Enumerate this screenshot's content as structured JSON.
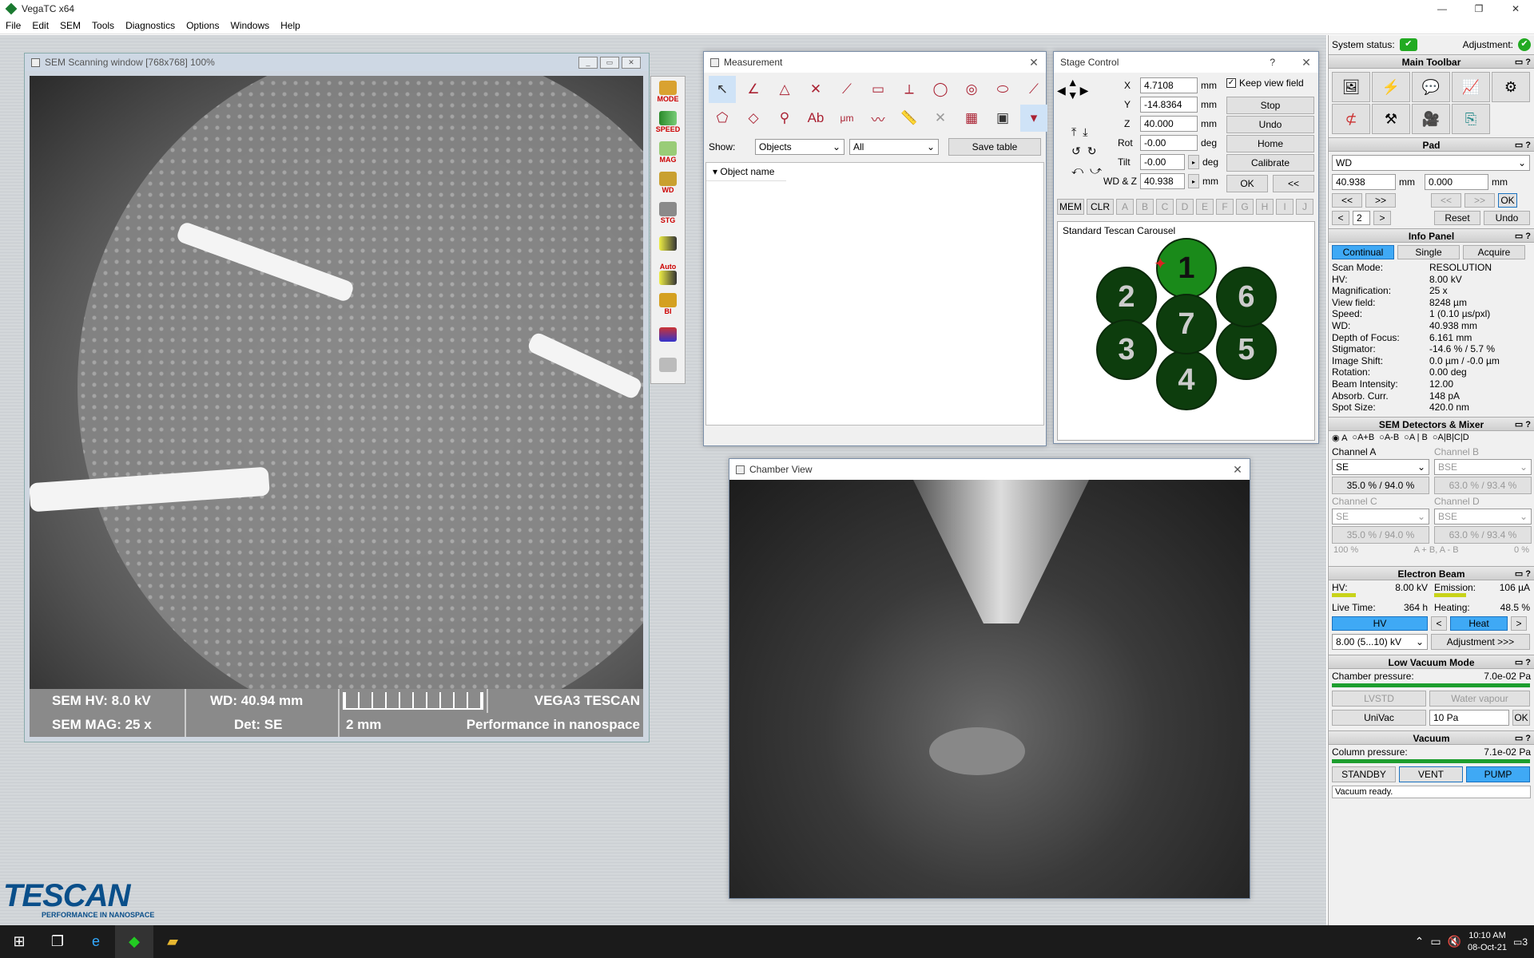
{
  "app": {
    "title": "VegaTC x64"
  },
  "menu": [
    "File",
    "Edit",
    "SEM",
    "Tools",
    "Diagnostics",
    "Options",
    "Windows",
    "Help"
  ],
  "sem_window": {
    "title": "SEM Scanning window [768x768] 100%",
    "hv": "SEM HV: 8.0 kV",
    "wd": "WD: 40.94 mm",
    "brand": "VEGA3 TESCAN",
    "mag": "SEM MAG: 25 x",
    "det": "Det: SE",
    "scale": "2 mm",
    "slogan": "Performance in nanospace"
  },
  "side_tools": [
    "MODE",
    "SPEED",
    "MAG",
    "WD",
    "STG",
    "",
    "Auto",
    "BI",
    "",
    ""
  ],
  "measurement": {
    "title": "Measurement",
    "show_label": "Show:",
    "show_value": "Objects",
    "filter_value": "All",
    "save_label": "Save table",
    "col_header": "Object name"
  },
  "stage": {
    "title": "Stage Control",
    "help": "?",
    "x_label": "X",
    "x": "4.7108",
    "y_label": "Y",
    "y": "-14.8364",
    "z_label": "Z",
    "z": "40.000",
    "rot_label": "Rot",
    "rot": "-0.00",
    "tilt_label": "Tilt",
    "tilt": "-0.00",
    "wdz_label": "WD & Z",
    "wdz": "40.938",
    "mm": "mm",
    "deg": "deg",
    "keep_view": "Keep view field",
    "stop": "Stop",
    "undo": "Undo",
    "home": "Home",
    "calibrate": "Calibrate",
    "ok": "OK",
    "back": "<<",
    "mem": "MEM",
    "clr": "CLR",
    "letters": [
      "A",
      "B",
      "C",
      "D",
      "E",
      "F",
      "G",
      "H",
      "I",
      "J"
    ],
    "carousel_title": "Standard Tescan Carousel",
    "positions": [
      "1",
      "2",
      "3",
      "4",
      "5",
      "6",
      "7"
    ]
  },
  "chamber": {
    "title": "Chamber View"
  },
  "right_panel": {
    "system_status": "System status:",
    "adjustment": "Adjustment:",
    "main_toolbar": "Main Toolbar",
    "pad": {
      "title": "Pad",
      "mode": "WD",
      "v1": "40.938",
      "u1": "mm",
      "v2": "0.000",
      "u2": "mm",
      "b1": "<<",
      "b2": ">>",
      "b3": "<<",
      "b4": ">>",
      "ok": "OK",
      "lt": "<",
      "num": "2",
      "gt": ">",
      "reset": "Reset",
      "undo": "Undo"
    },
    "info": {
      "title": "Info Panel",
      "tabs": [
        "Continual",
        "Single",
        "Acquire"
      ],
      "rows": [
        [
          "Scan Mode:",
          "RESOLUTION"
        ],
        [
          "HV:",
          "8.00 kV"
        ],
        [
          "Magnification:",
          "25 x"
        ],
        [
          "View field:",
          "8248 µm"
        ],
        [
          "Speed:",
          "1 (0.10 µs/pxl)"
        ],
        [
          "WD:",
          "40.938 mm"
        ],
        [
          "Depth of Focus:",
          "6.161 mm"
        ],
        [
          "Stigmator:",
          "-14.6 % / 5.7 %"
        ],
        [
          "Image Shift:",
          "0.0 µm / -0.0 µm"
        ],
        [
          "Rotation:",
          "0.00 deg"
        ],
        [
          "Beam Intensity:",
          "12.00"
        ],
        [
          "Absorb. Curr.",
          "148 pA"
        ],
        [
          "Spot Size:",
          "420.0 nm"
        ]
      ]
    },
    "detectors": {
      "title": "SEM Detectors & Mixer",
      "radios": [
        "A",
        "A+B",
        "A-B",
        "A | B",
        "A|B|C|D"
      ],
      "chA": "Channel A",
      "chB": "Channel B",
      "chA_val": "SE",
      "chB_val": "BSE",
      "chA_pct": "35.0 % / 94.0 %",
      "chB_pct": "63.0 % / 93.4 %",
      "chC": "Channel C",
      "chD": "Channel D",
      "chC_val": "SE",
      "chD_val": "BSE",
      "chC_pct": "35.0 % / 94.0 %",
      "chD_pct": "63.0 % / 93.4 %",
      "mix_l": "100 %",
      "mix_m": "A + B, A - B",
      "mix_r": "0 %"
    },
    "beam": {
      "title": "Electron Beam",
      "hv_l": "HV:",
      "hv": "8.00 kV",
      "em_l": "Emission:",
      "em": "106 µA",
      "lt_l": "Live Time:",
      "lt": "364 h",
      "ht_l": "Heating:",
      "ht": "48.5 %",
      "hv_btn": "HV",
      "heat_btn": "Heat",
      "lt_btn": "<",
      "gt_btn": ">",
      "range": "8.00 (5...10) kV",
      "adj": "Adjustment >>>"
    },
    "lowvac": {
      "title": "Low Vacuum Mode",
      "cp_l": "Chamber pressure:",
      "cp": "7.0e-02 Pa",
      "lvstd": "LVSTD",
      "water": "Water vapour",
      "univac": "UniVac",
      "pa": "10 Pa",
      "ok": "OK"
    },
    "vacuum": {
      "title": "Vacuum",
      "colp_l": "Column pressure:",
      "colp": "7.1e-02 Pa",
      "standby": "STANDBY",
      "vent": "VENT",
      "pump": "PUMP",
      "status": "Vacuum ready."
    }
  },
  "logo": {
    "name": "TESCAN",
    "tag": "PERFORMANCE IN NANOSPACE"
  },
  "taskbar": {
    "time": "10:10 AM",
    "date": "08-Oct-21",
    "notif": "3"
  }
}
